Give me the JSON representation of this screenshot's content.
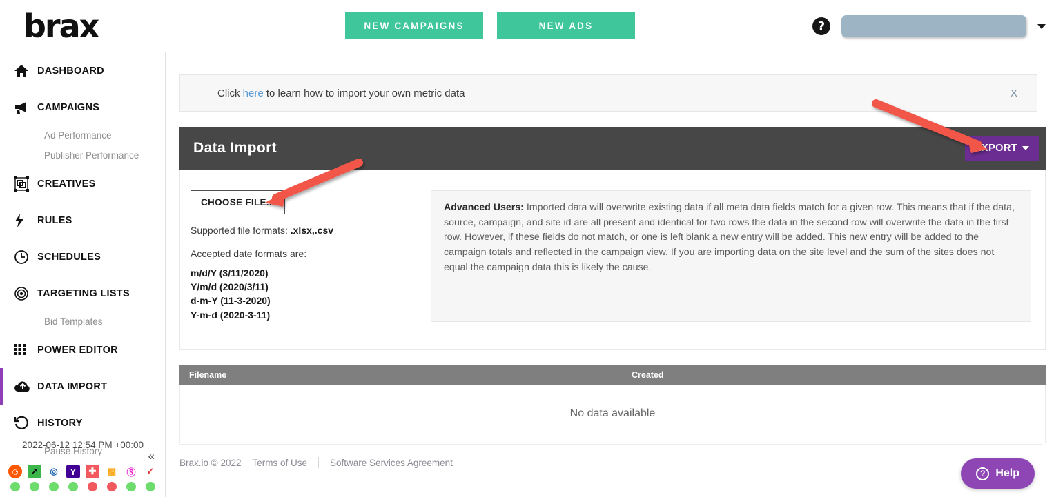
{
  "brand": {
    "logo_text": "brax",
    "accent_green": "#3fc69b",
    "accent_purple": "#6b2d91",
    "arrow_red": "#f2564a"
  },
  "topbar": {
    "new_campaigns_label": "NEW CAMPAIGNS",
    "new_ads_label": "NEW ADS",
    "help_icon_glyph": "?",
    "user_menu_value": ""
  },
  "sidebar": {
    "items": [
      {
        "label": "DASHBOARD",
        "icon": "home-icon",
        "active": false
      },
      {
        "label": "CAMPAIGNS",
        "icon": "megaphone-icon",
        "active": false
      },
      {
        "label": "CREATIVES",
        "icon": "creatives-icon",
        "active": false
      },
      {
        "label": "RULES",
        "icon": "bolt-icon",
        "active": false
      },
      {
        "label": "SCHEDULES",
        "icon": "clock-icon",
        "active": false
      },
      {
        "label": "TARGETING LISTS",
        "icon": "target-icon",
        "active": false
      },
      {
        "label": "POWER EDITOR",
        "icon": "grid-icon",
        "active": false
      },
      {
        "label": "DATA IMPORT",
        "icon": "cloud-upload-icon",
        "active": true
      },
      {
        "label": "HISTORY",
        "icon": "history-icon",
        "active": false
      }
    ],
    "sub_ad_performance": "Ad Performance",
    "sub_publisher_performance": "Publisher Performance",
    "sub_bid_templates": "Bid Templates",
    "sub_pause_history": "Pause History",
    "timestamp": "2022-06-12 12:54 PM +00:00",
    "collapse_glyph": "«",
    "platforms": [
      {
        "name": "reddit-icon",
        "glyph": "◉",
        "color": "#ff5700",
        "status": "#6ddc6d"
      },
      {
        "name": "outbrain-icon",
        "glyph": "⬈",
        "color": "#3cb54a",
        "status": "#6ddc6d"
      },
      {
        "name": "taboola-icon",
        "glyph": "◕",
        "color": "#1763b0",
        "status": "#6ddc6d"
      },
      {
        "name": "yahoo-gemini-icon",
        "glyph": "Y",
        "color": "#ffffff",
        "status": "#6ddc6d"
      },
      {
        "name": "pinterest-icon",
        "glyph": "✚",
        "color": "#ffffff",
        "status": "#f2595f"
      },
      {
        "name": "analytics-icon",
        "glyph": "▃",
        "color": "#fbab21",
        "status": "#f2595f"
      },
      {
        "name": "revcontent-icon",
        "glyph": "ⓥ",
        "color": "#e81fce",
        "status": "#6ddc6d"
      },
      {
        "name": "check-icon",
        "glyph": "✓",
        "color": "#e23b3b",
        "status": "#6ddc6d"
      }
    ]
  },
  "notice": {
    "prefix": "Click ",
    "link": "here",
    "suffix": " to learn how to import your own metric data",
    "close_label": "X"
  },
  "panel": {
    "title": "Data Import",
    "export_label": "EXPORT",
    "choose_file_label": "CHOOSE FILE...",
    "supported_label": "Supported file formats: ",
    "supported_value": ".xlsx,.csv",
    "accepted_label": "Accepted date formats are:",
    "date_formats": [
      "m/d/Y (3/11/2020)",
      "Y/m/d (2020/3/11)",
      "d-m-Y (11-3-2020)",
      "Y-m-d (2020-3-11)"
    ],
    "advanced_title": "Advanced Users:",
    "advanced_text": " Imported data will overwrite existing data if all meta data fields match for a given row. This means that if the data, source, campaign, and site id are all present and identical for two rows the data in the second row will overwrite the data in the first row. However, if these fields do not match, or one is left blank a new entry will be added. This new entry will be added to the campaign totals and reflected in the campaign view. If you are importing data on the site level and the sum of the sites does not equal the campaign data this is likely the cause."
  },
  "table": {
    "columns": [
      "Filename",
      "Created"
    ],
    "empty_message": "No data available"
  },
  "footer": {
    "copyright": "Brax.io © 2022",
    "terms": "Terms of Use",
    "agreement": "Software Services Agreement"
  },
  "help_widget": {
    "label": "Help",
    "icon_glyph": "?"
  }
}
